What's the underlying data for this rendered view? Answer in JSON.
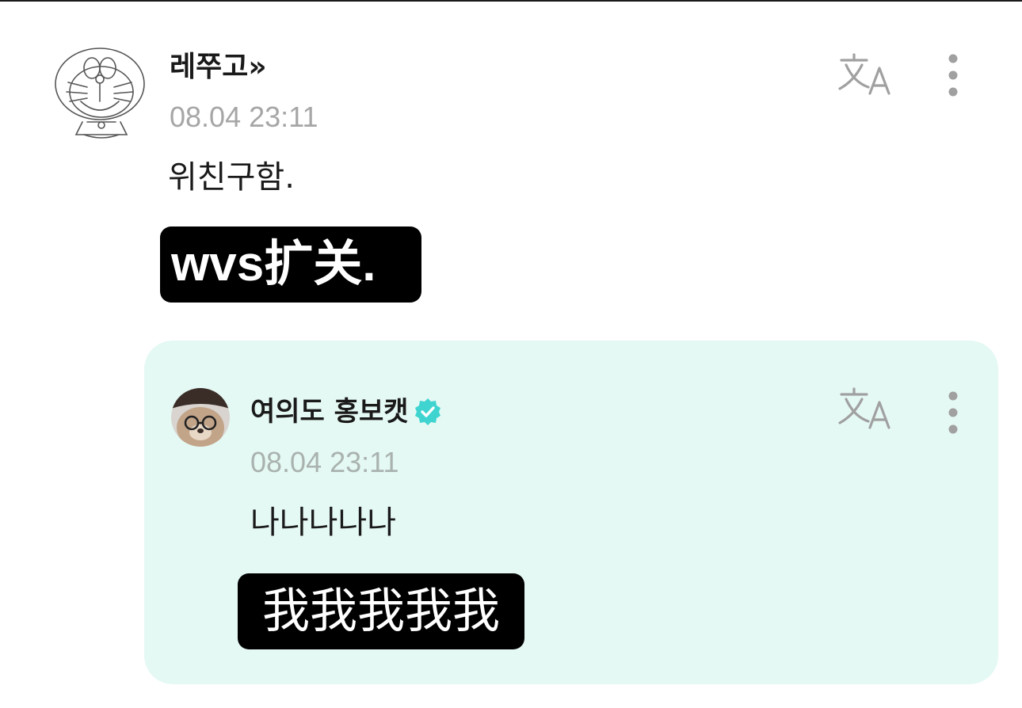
{
  "comment": {
    "username": "레쭈고»",
    "timestamp": "08.04 23:11",
    "text": "위친구함.",
    "caption_overlay": "wvs扩关.",
    "avatar": "doraemon-doodle-avatar",
    "icons": {
      "translate": "translate-icon",
      "more": "more-vertical-icon"
    }
  },
  "reply": {
    "username": "여의도 홍보캣",
    "verified": true,
    "timestamp": "08.04 23:11",
    "text": "나나나나나",
    "caption_overlay": "我我我我我",
    "avatar": "bear-hat-avatar",
    "icons": {
      "translate": "translate-icon",
      "more": "more-vertical-icon",
      "verified": "verified-badge-icon"
    }
  },
  "colors": {
    "reply_background": "#e5f9f4",
    "verified_badge": "#3fd4d0",
    "timestamp": "#a6a6a6",
    "icon_gray": "#a0a0a0",
    "caption_background": "#000000",
    "caption_text": "#ffffff"
  }
}
